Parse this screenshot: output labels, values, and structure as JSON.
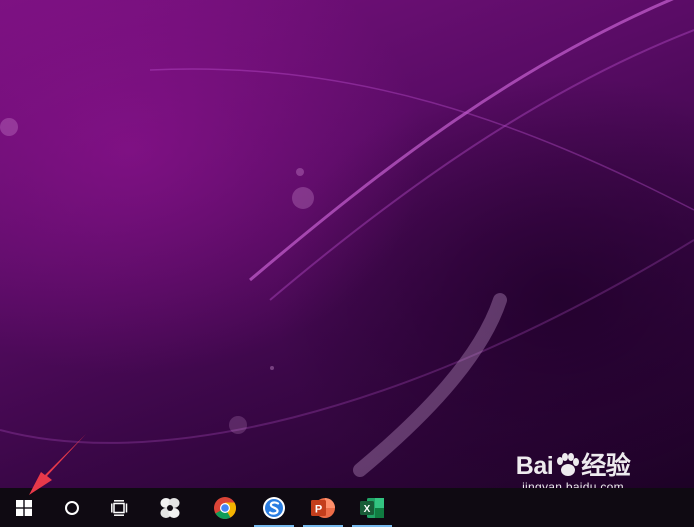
{
  "watermark": {
    "brand_left": "Bai",
    "brand_right": "经验",
    "url": "jingyan.baidu.com"
  },
  "taskbar": {
    "items": [
      {
        "icon": "windows-start-icon"
      },
      {
        "icon": "cortana-search-icon"
      },
      {
        "icon": "task-view-icon"
      },
      {
        "icon": "fan-app-icon"
      },
      {
        "icon": "chrome-icon"
      },
      {
        "icon": "sogou-browser-icon",
        "active": true
      },
      {
        "icon": "powerpoint-icon",
        "letter": "P",
        "active": true
      },
      {
        "icon": "excel-icon",
        "letter": "X",
        "active": true
      }
    ]
  },
  "colors": {
    "taskbar": "#0f0a12",
    "active_indicator": "#76b9ed",
    "annotation_arrow": "#e8394a",
    "powerpoint": "#d24726",
    "excel": "#1d7a45"
  }
}
